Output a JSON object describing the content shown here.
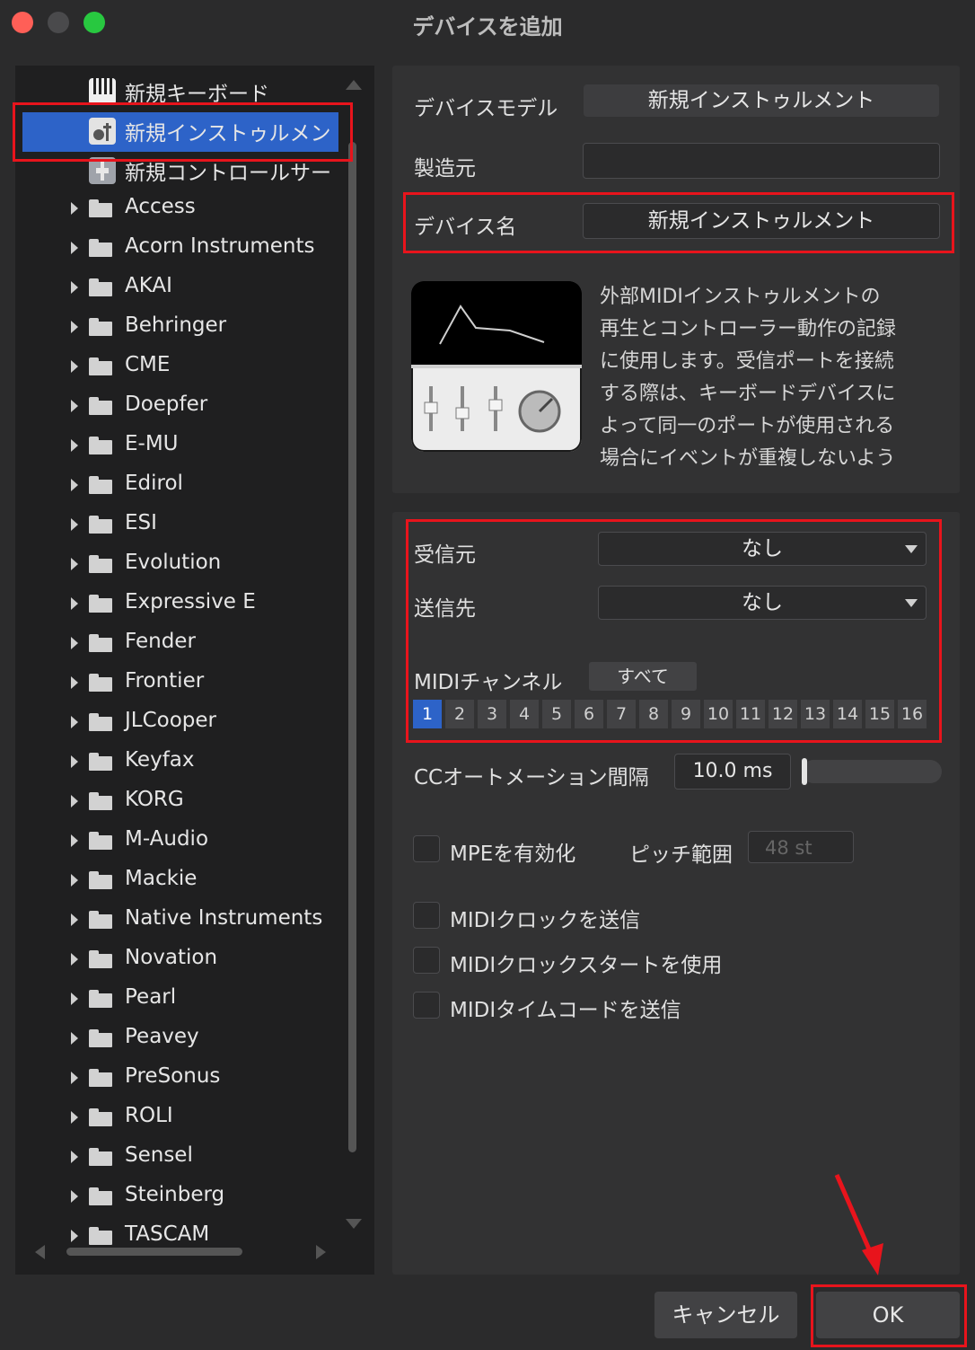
{
  "window": {
    "title": "デバイスを追加"
  },
  "tree": {
    "devices": [
      {
        "label": "新規キーボード",
        "icon": "keyboard-icon"
      },
      {
        "label": "新規インストゥルメン",
        "icon": "instrument-icon",
        "selected": true
      },
      {
        "label": "新規コントロールサー",
        "icon": "control-surface-icon"
      }
    ],
    "folders": [
      "Access",
      "Acorn Instruments",
      "AKAI",
      "Behringer",
      "CME",
      "Doepfer",
      "E-MU",
      "Edirol",
      "ESI",
      "Evolution",
      "Expressive E",
      "Fender",
      "Frontier",
      "JLCooper",
      "Keyfax",
      "KORG",
      "M-Audio",
      "Mackie",
      "Native Instruments",
      "Novation",
      "Pearl",
      "Peavey",
      "PreSonus",
      "ROLI",
      "Sensel",
      "Steinberg",
      "TASCAM"
    ]
  },
  "form": {
    "model_label": "デバイスモデル",
    "model_value": "新規インストゥルメント",
    "manufacturer_label": "製造元",
    "manufacturer_value": "",
    "name_label": "デバイス名",
    "name_value": "新規インストゥルメント",
    "description_lines": [
      "外部MIDIインストゥルメントの",
      "再生とコントローラー動作の記録",
      "に使用します。受信ポートを接続",
      "する際は、キーボードデバイスに",
      "よって同一のポートが使用される",
      "場合にイベントが重複しないよう"
    ]
  },
  "midi": {
    "receive_label": "受信元",
    "receive_value": "なし",
    "send_label": "送信先",
    "send_value": "なし",
    "channel_label": "MIDIチャンネル",
    "all_label": "すべて",
    "channels": [
      "1",
      "2",
      "3",
      "4",
      "5",
      "6",
      "7",
      "8",
      "9",
      "10",
      "11",
      "12",
      "13",
      "14",
      "15",
      "16"
    ],
    "active_channel": "1"
  },
  "cc": {
    "label": "CCオートメーション間隔",
    "value": "10.0 ms",
    "slider_fraction": 0.0
  },
  "options": {
    "mpe_label": "MPEを有効化",
    "pitch_label": "ピッチ範囲",
    "pitch_value": "48 st",
    "clock_send_label": "MIDIクロックを送信",
    "clock_start_label": "MIDIクロックスタートを使用",
    "timecode_label": "MIDIタイムコードを送信"
  },
  "buttons": {
    "cancel": "キャンセル",
    "ok": "OK"
  },
  "colors": {
    "accent": "#2d63c8",
    "annotation": "#e8141c"
  }
}
